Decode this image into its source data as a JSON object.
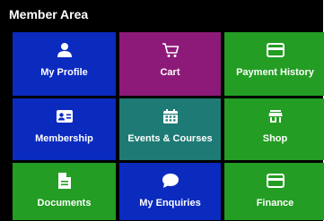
{
  "header": {
    "title": "Member Area"
  },
  "tiles": [
    {
      "label": "My Profile",
      "icon": "user-icon",
      "color": "#0b2bbf"
    },
    {
      "label": "Cart",
      "icon": "cart-icon",
      "color": "#8d1a78"
    },
    {
      "label": "Payment History",
      "icon": "credit-card-icon",
      "color": "#239d23"
    },
    {
      "label": "Membership",
      "icon": "id-card-icon",
      "color": "#0b2bbf"
    },
    {
      "label": "Events & Courses",
      "icon": "calendar-icon",
      "color": "#1d7a74"
    },
    {
      "label": "Shop",
      "icon": "store-icon",
      "color": "#239d23"
    },
    {
      "label": "Documents",
      "icon": "document-icon",
      "color": "#239d23"
    },
    {
      "label": "My Enquiries",
      "icon": "chat-bubble-icon",
      "color": "#0b2bbf"
    },
    {
      "label": "Finance",
      "icon": "credit-card-icon",
      "color": "#239d23"
    }
  ]
}
